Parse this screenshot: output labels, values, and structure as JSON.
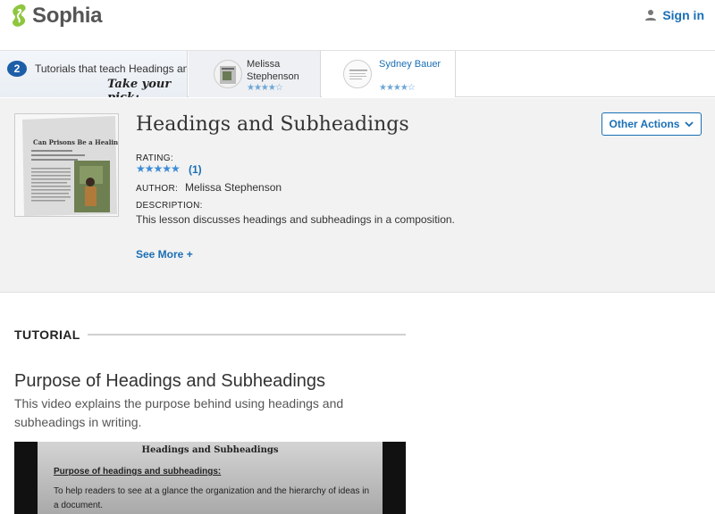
{
  "header": {
    "brand": "Sophia",
    "signin_label": "Sign in",
    "brand_color": "#8ec63f",
    "link_color": "#1a6fb5"
  },
  "strip": {
    "count": "2",
    "intro_text": "Tutorials that teach Headings and Subheadings",
    "pick_text": "Take your pick:",
    "cards": [
      {
        "name": "Melissa Stephenson",
        "stars": "★★★★☆"
      },
      {
        "name": "Sydney Bauer",
        "stars": "★★★★☆"
      }
    ]
  },
  "lesson": {
    "title": "Headings and Subheadings",
    "actions_label": "Other Actions",
    "rating_label": "RATING:",
    "rating_stars": "★★★★★",
    "rating_count": "(1)",
    "author_label": "AUTHOR:",
    "author_name": "Melissa Stephenson",
    "description_label": "DESCRIPTION:",
    "description": "This lesson discusses headings and subheadings in a composition.",
    "see_more": "See More +",
    "cover_title": "Can Prisons Be a Healing Place?"
  },
  "tutorial": {
    "section_label": "TUTORIAL",
    "title": "Purpose of Headings and Subheadings",
    "description": "This video explains the purpose behind using headings and subheadings in writing.",
    "video": {
      "page_title": "Headings and Subheadings",
      "subheading": "Purpose of headings and subheadings:",
      "body": "To help readers to see at a glance the organization and the hierarchy of ideas in a document."
    }
  }
}
